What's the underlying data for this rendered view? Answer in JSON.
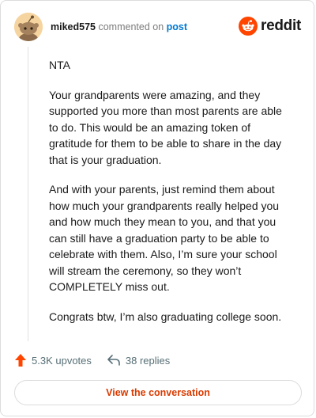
{
  "header": {
    "username": "miked575",
    "commented_on": "commented on",
    "post_link": "post",
    "logo_text": "reddit"
  },
  "comment": {
    "paragraphs": [
      "NTA",
      "Your grandparents were amazing, and they supported you more than most parents are able to do. This would be an amazing token of gratitude for them to be able to share in the day that is your graduation.",
      "And with your parents, just remind them about how much your grandparents really helped you and how much they mean to you, and that you can still have a graduation party to be able to celebrate with them. Also, I’m sure your school will stream the ceremony, so they won’t COMPLETELY miss out.",
      "Congrats btw, I’m also graduating college soon."
    ]
  },
  "actions": {
    "upvotes": "5.3K upvotes",
    "replies": "38 replies"
  },
  "cta": {
    "label": "View the conversation"
  },
  "colors": {
    "brand": "#ff4500",
    "cta_text": "#d93a00",
    "link": "#0079d3"
  },
  "icons": {
    "avatar": "snoo-avatar",
    "logo": "reddit-logo-icon",
    "upvote": "upvote-arrow-icon",
    "reply": "reply-arrow-icon"
  }
}
